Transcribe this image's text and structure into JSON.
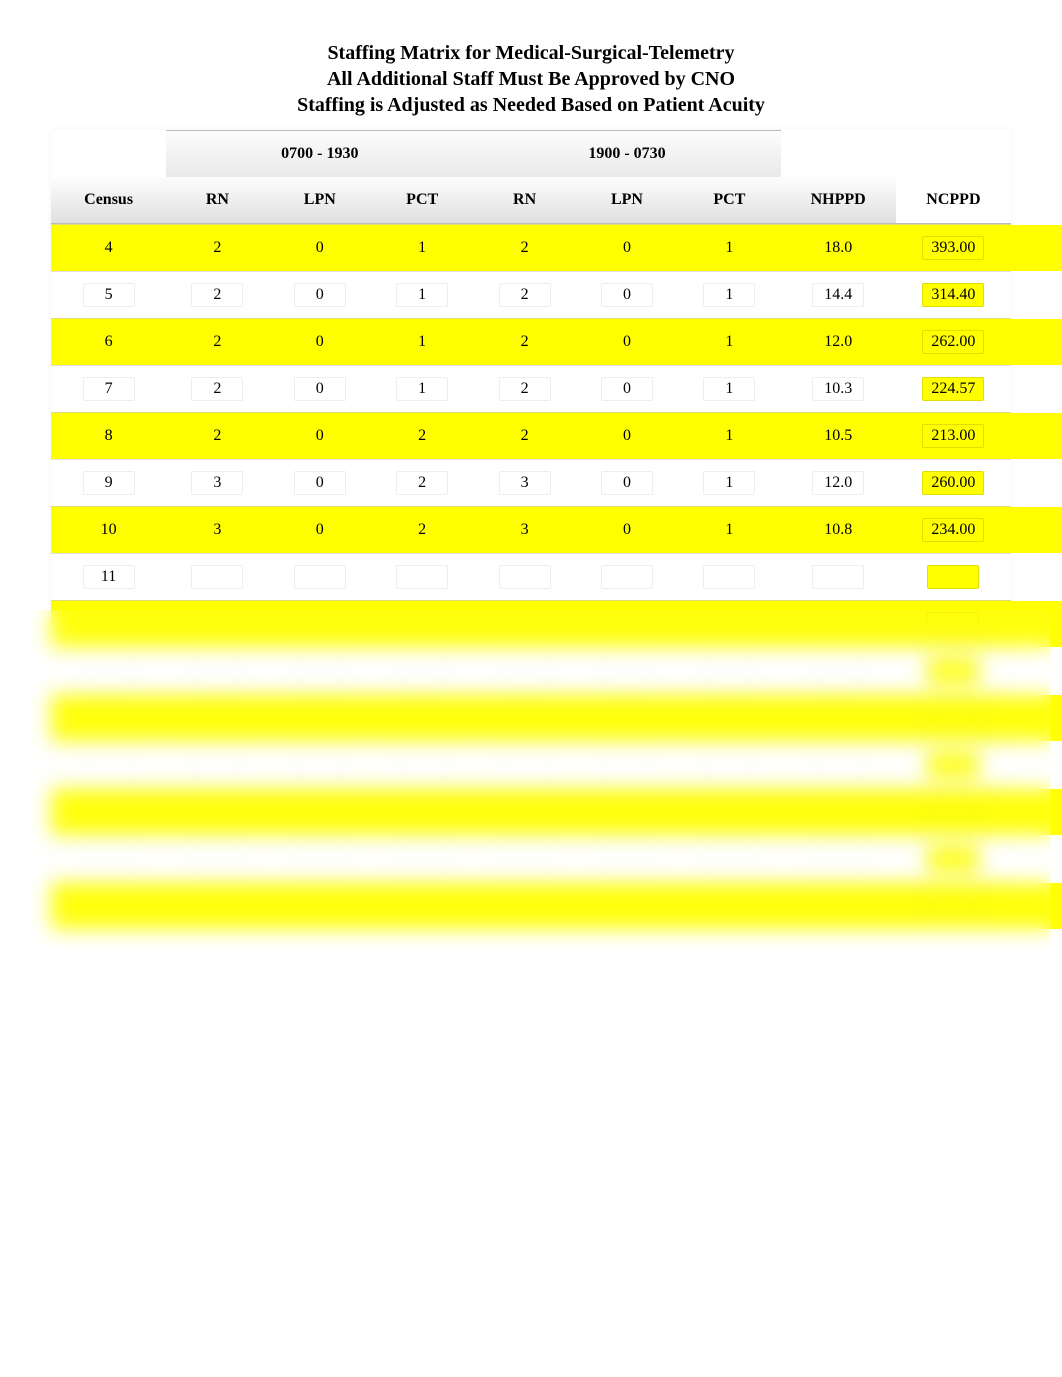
{
  "title": {
    "line1": "Staffing Matrix for Medical-Surgical-Telemetry",
    "line2": "All Additional Staff Must Be Approved by CNO",
    "line3": "Staffing is Adjusted as Needed Based on Patient Acuity"
  },
  "shifts": {
    "day": "0700 - 1930",
    "night": "1900 - 0730"
  },
  "columns": {
    "census": "Census",
    "rn1": "RN",
    "lpn1": "LPN",
    "pct1": "PCT",
    "rn2": "RN",
    "lpn2": "LPN",
    "pct2": "PCT",
    "nhppd": "NHPPD",
    "ncppd": "NCPPD"
  },
  "chart_data": {
    "type": "table",
    "title": "Staffing Matrix for Medical-Surgical-Telemetry",
    "columns": [
      "Census",
      "RN_day",
      "LPN_day",
      "PCT_day",
      "RN_night",
      "LPN_night",
      "PCT_night",
      "NHPPD",
      "NCPPD"
    ],
    "rows": [
      {
        "census": 4,
        "rn1": 2,
        "lpn1": 0,
        "pct1": 1,
        "rn2": 2,
        "lpn2": 0,
        "pct2": 1,
        "nhppd": "18.0",
        "ncppd": "393.00",
        "highlight": true
      },
      {
        "census": 5,
        "rn1": 2,
        "lpn1": 0,
        "pct1": 1,
        "rn2": 2,
        "lpn2": 0,
        "pct2": 1,
        "nhppd": "14.4",
        "ncppd": "314.40",
        "highlight": false
      },
      {
        "census": 6,
        "rn1": 2,
        "lpn1": 0,
        "pct1": 1,
        "rn2": 2,
        "lpn2": 0,
        "pct2": 1,
        "nhppd": "12.0",
        "ncppd": "262.00",
        "highlight": true
      },
      {
        "census": 7,
        "rn1": 2,
        "lpn1": 0,
        "pct1": 1,
        "rn2": 2,
        "lpn2": 0,
        "pct2": 1,
        "nhppd": "10.3",
        "ncppd": "224.57",
        "highlight": false
      },
      {
        "census": 8,
        "rn1": 2,
        "lpn1": 0,
        "pct1": 2,
        "rn2": 2,
        "lpn2": 0,
        "pct2": 1,
        "nhppd": "10.5",
        "ncppd": "213.00",
        "highlight": true
      },
      {
        "census": 9,
        "rn1": 3,
        "lpn1": 0,
        "pct1": 2,
        "rn2": 3,
        "lpn2": 0,
        "pct2": 1,
        "nhppd": "12.0",
        "ncppd": "260.00",
        "highlight": false
      },
      {
        "census": 10,
        "rn1": 3,
        "lpn1": 0,
        "pct1": 2,
        "rn2": 3,
        "lpn2": 0,
        "pct2": 1,
        "nhppd": "10.8",
        "ncppd": "234.00",
        "highlight": true
      },
      {
        "census": 11,
        "rn1": "",
        "lpn1": "",
        "pct1": "",
        "rn2": "",
        "lpn2": "",
        "pct2": "",
        "nhppd": "",
        "ncppd": "",
        "highlight": false
      },
      {
        "census": "",
        "rn1": "",
        "lpn1": "",
        "pct1": "",
        "rn2": "",
        "lpn2": "",
        "pct2": "",
        "nhppd": "",
        "ncppd": "",
        "highlight": true
      },
      {
        "census": "",
        "rn1": "",
        "lpn1": "",
        "pct1": "",
        "rn2": "",
        "lpn2": "",
        "pct2": "",
        "nhppd": "",
        "ncppd": "",
        "highlight": false
      },
      {
        "census": "",
        "rn1": "",
        "lpn1": "",
        "pct1": "",
        "rn2": "",
        "lpn2": "",
        "pct2": "",
        "nhppd": "",
        "ncppd": "",
        "highlight": true
      },
      {
        "census": "",
        "rn1": "",
        "lpn1": "",
        "pct1": "",
        "rn2": "",
        "lpn2": "",
        "pct2": "",
        "nhppd": "",
        "ncppd": "",
        "highlight": false
      },
      {
        "census": "",
        "rn1": "",
        "lpn1": "",
        "pct1": "",
        "rn2": "",
        "lpn2": "",
        "pct2": "",
        "nhppd": "",
        "ncppd": "",
        "highlight": true
      },
      {
        "census": "",
        "rn1": "",
        "lpn1": "",
        "pct1": "",
        "rn2": "",
        "lpn2": "",
        "pct2": "",
        "nhppd": "",
        "ncppd": "",
        "highlight": false
      },
      {
        "census": "",
        "rn1": "",
        "lpn1": "",
        "pct1": "",
        "rn2": "",
        "lpn2": "",
        "pct2": "",
        "nhppd": "",
        "ncppd": "",
        "highlight": true
      }
    ]
  }
}
